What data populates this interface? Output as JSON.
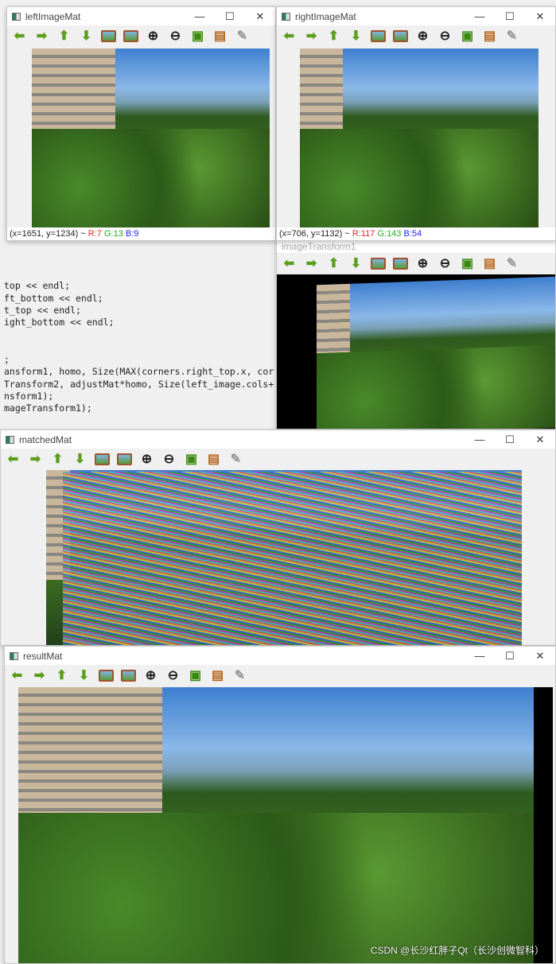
{
  "windows": {
    "left": {
      "title": "leftImageMat",
      "status": {
        "coords": "(x=1651, y=1234) ~",
        "r": "R:7",
        "g": "G:13",
        "b": "B:9"
      }
    },
    "right": {
      "title": "rightImageMat",
      "status": {
        "coords": "(x=706, y=1132) ~",
        "r": "R:117",
        "g": "G:143",
        "b": "B:54"
      }
    },
    "transform": {
      "title": "imageTransform1"
    },
    "matched": {
      "title": "matchedMat"
    },
    "result": {
      "title": "resultMat"
    }
  },
  "controls": {
    "minimize": "—",
    "maximize": "☐",
    "close": "✕"
  },
  "toolbar_icons": [
    "arrow-left",
    "arrow-right",
    "arrow-up",
    "arrow-down",
    "fit-image",
    "zoom-region",
    "zoom-in",
    "zoom-out",
    "save",
    "copy-clipboard",
    "properties-brush"
  ],
  "code_lines": [
    "top << endl;",
    "ft_bottom << endl;",
    "t_top << endl;",
    "ight_bottom << endl;",
    "",
    ";",
    "ansform1, homo, Size(MAX(corners.right_top.x, cor",
    "Transform2, adjustMat*homo, Size(left_image.cols+",
    "nsform1);",
    "mageTransform1);"
  ],
  "watermark": "CSDN @长沙红胖子Qt（长沙创微智科）"
}
